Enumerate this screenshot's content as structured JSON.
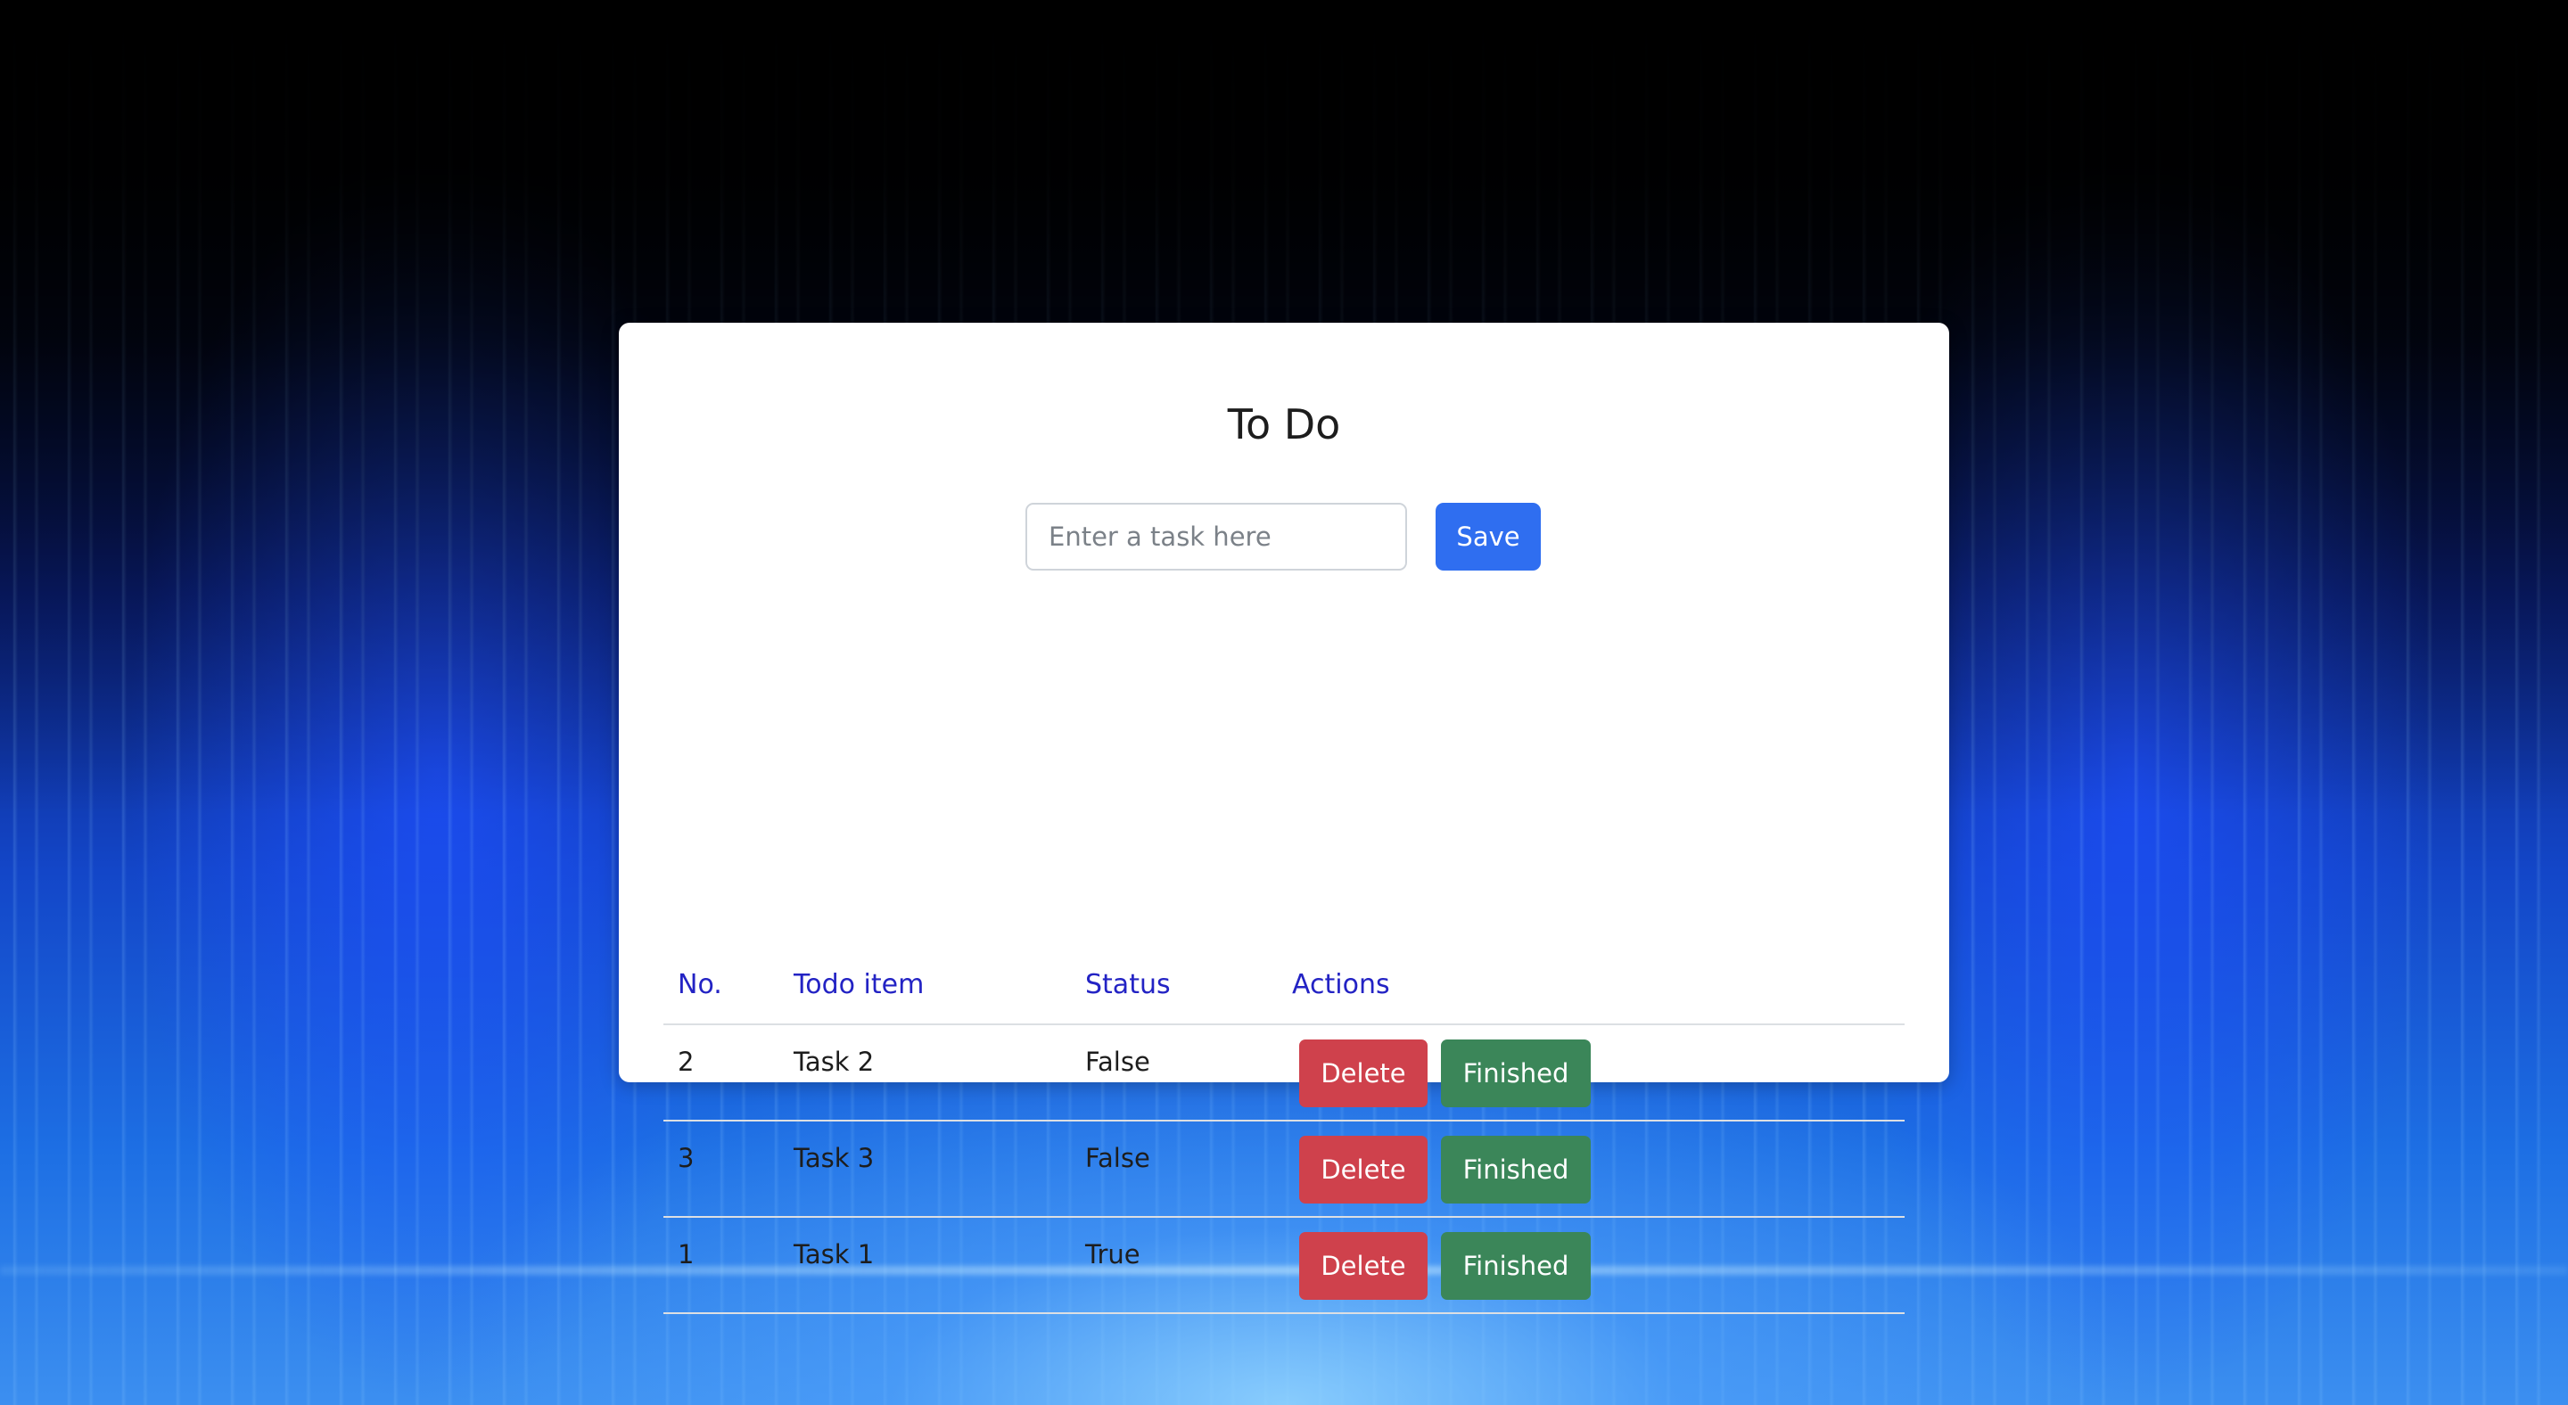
{
  "title": "To Do",
  "input": {
    "placeholder": "Enter a task here",
    "value": ""
  },
  "save_label": "Save",
  "table": {
    "headers": {
      "no": "No.",
      "item": "Todo item",
      "status": "Status",
      "actions": "Actions"
    },
    "rows": [
      {
        "no": "2",
        "item": "Task 2",
        "status": "False",
        "delete_label": "Delete",
        "finished_label": "Finished"
      },
      {
        "no": "3",
        "item": "Task 3",
        "status": "False",
        "delete_label": "Delete",
        "finished_label": "Finished"
      },
      {
        "no": "1",
        "item": "Task 1",
        "status": "True",
        "delete_label": "Delete",
        "finished_label": "Finished"
      }
    ]
  },
  "colors": {
    "header_text": "#2323c4",
    "save_button": "#2f6ef0",
    "delete_button": "#cf414c",
    "finished_button": "#3b8659"
  }
}
